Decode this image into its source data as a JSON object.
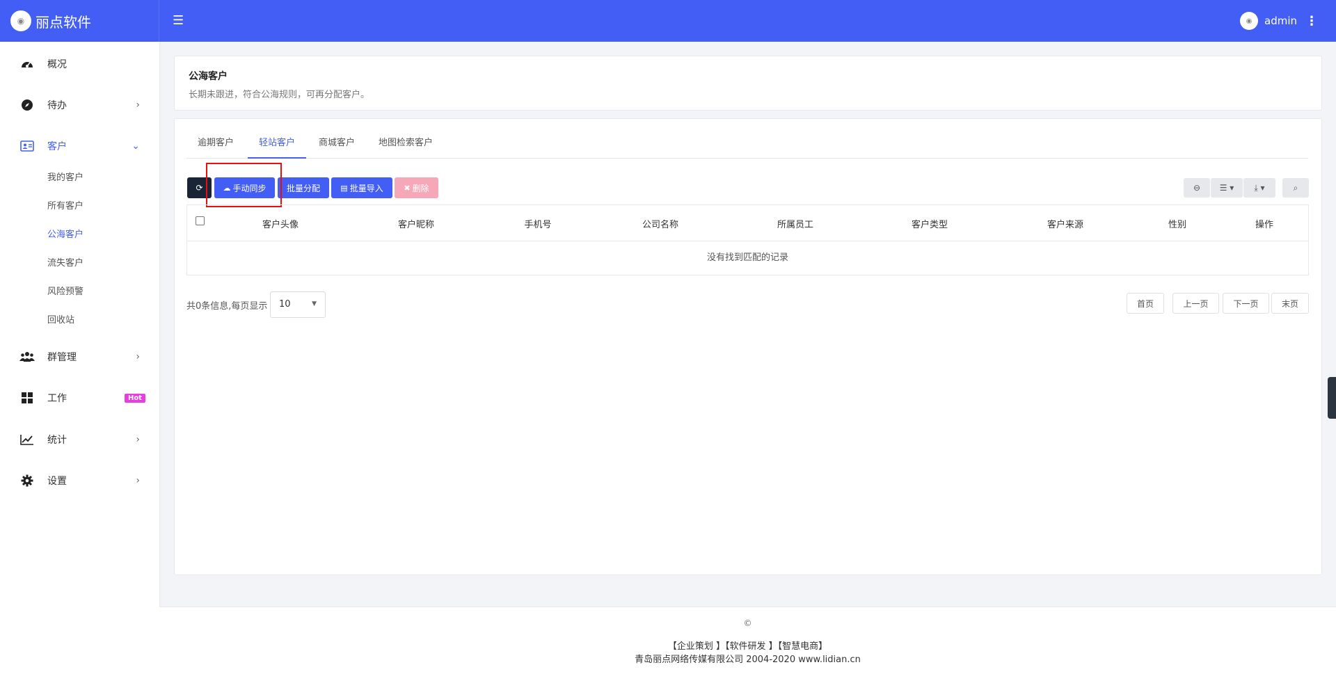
{
  "brand": {
    "name": "丽点软件"
  },
  "user": {
    "name": "admin"
  },
  "sidebar": {
    "items": [
      {
        "label": "概况",
        "icon": "dashboard-icon"
      },
      {
        "label": "待办",
        "icon": "compass-icon",
        "arrow": "›"
      },
      {
        "label": "客户",
        "icon": "address-card-icon",
        "arrow": "⌄"
      },
      {
        "label": "群管理",
        "icon": "users-icon",
        "arrow": "›"
      },
      {
        "label": "工作",
        "icon": "grid-icon",
        "badge": "Hot"
      },
      {
        "label": "统计",
        "icon": "line-chart-icon",
        "arrow": "›"
      },
      {
        "label": "设置",
        "icon": "gear-icon",
        "arrow": "›"
      }
    ],
    "sub_items": [
      "我的客户",
      "所有客户",
      "公海客户",
      "流失客户",
      "风险预警",
      "回收站"
    ]
  },
  "page": {
    "title": "公海客户",
    "description": "长期未跟进，符合公海规则，可再分配客户。"
  },
  "tabs": [
    "逾期客户",
    "轻站客户",
    "商城客户",
    "地图检索客户"
  ],
  "toolbar": {
    "sync": "手动同步",
    "batch_assign": "批量分配",
    "batch_import": "批量导入",
    "delete": "删除"
  },
  "table": {
    "columns": [
      "客户头像",
      "客户昵称",
      "手机号",
      "公司名称",
      "所属员工",
      "客户类型",
      "客户来源",
      "性别",
      "操作"
    ],
    "empty_text": "没有找到匹配的记录"
  },
  "pagination": {
    "total_text": "共0条信息,每页显示",
    "page_size": "10",
    "first": "首页",
    "prev": "上一页",
    "next": "下一页",
    "last": "末页"
  },
  "footer": {
    "copyright": "©",
    "links": "【企业策划 】【软件研发 】【智慧电商】",
    "company": "青岛丽点网络传媒有限公司 2004-2020 www.lidian.cn"
  }
}
